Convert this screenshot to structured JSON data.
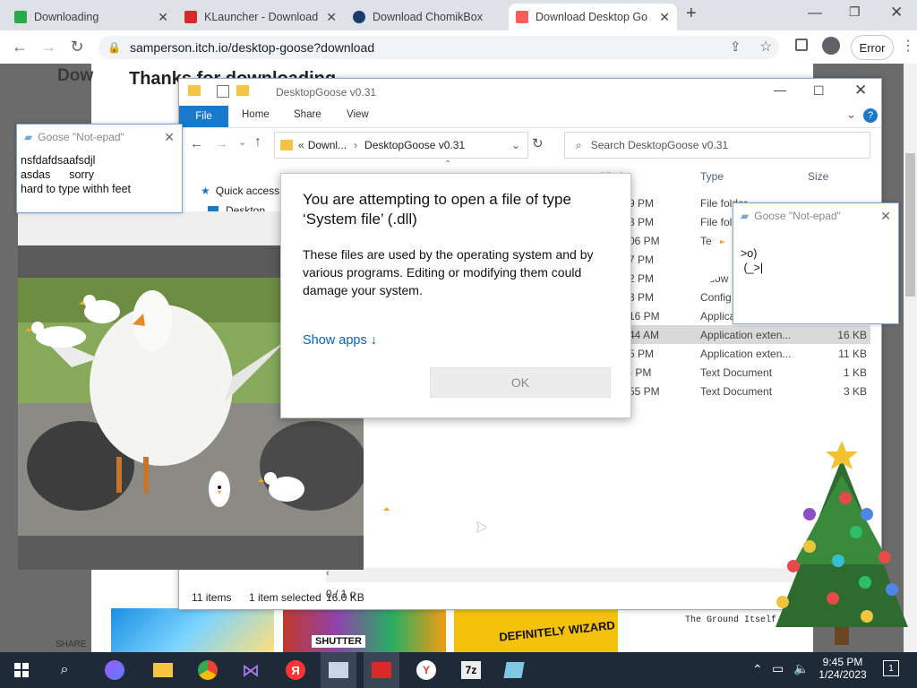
{
  "browser": {
    "tabs": [
      {
        "title": "Downloading",
        "favicon_color": "#2aa84a",
        "active": false
      },
      {
        "title": "KLauncher - Download",
        "favicon_color": "#d92a2a",
        "active": false
      },
      {
        "title": "Download ChomikBox",
        "favicon_color": "#1b3b6f",
        "active": false
      },
      {
        "title": "Download Desktop Go",
        "favicon_color": "#fa5c5c",
        "active": true
      }
    ],
    "url": "samperson.itch.io/desktop-goose?download",
    "error_label": "Error"
  },
  "page": {
    "heading_partial": "Thanks for downloading",
    "left_partial": "Dow",
    "share_partial": "SHARE",
    "bottom_card_text": "The Ground Itself",
    "card_shutter": "SHUTTER",
    "card_wizard": "DEFINITELY WIZARD"
  },
  "explorer": {
    "title": "DesktopGoose v0.31",
    "ribbon_tabs": [
      "File",
      "Home",
      "Share",
      "View"
    ],
    "path": [
      "Downl...",
      "DesktopGoose v0.31"
    ],
    "search_placeholder": "Search DesktopGoose v0.31",
    "nav_items": [
      "Quick access",
      "Desktop"
    ],
    "columns": [
      "modified",
      "Type",
      "Size"
    ],
    "rows": [
      {
        "time": "9 PM",
        "type": "File folder",
        "size": "",
        "selected": false
      },
      {
        "time": "3 PM",
        "type": "File fold",
        "size": "",
        "selected": false
      },
      {
        "time": "06 PM",
        "type": "Te",
        "size": "",
        "selected": false
      },
      {
        "time": "7 PM",
        "type": "",
        "size": "",
        "selected": false
      },
      {
        "time": "2 PM",
        "type": "indow",
        "size": "",
        "selected": false
      },
      {
        "time": "3 PM",
        "type": "Config",
        "size": "",
        "selected": false
      },
      {
        "time": "16 PM",
        "type": "Applica",
        "size": "",
        "selected": false
      },
      {
        "time": "44 AM",
        "type": "Application exten...",
        "size": "16 KB",
        "selected": true
      },
      {
        "time": "5 PM",
        "type": "Application exten...",
        "size": "11 KB",
        "selected": false
      },
      {
        "time": ") PM",
        "type": "Text Document",
        "size": "1 KB",
        "selected": false
      },
      {
        "time": "55 PM",
        "type": "Text Document",
        "size": "3 KB",
        "selected": false
      }
    ],
    "status": {
      "items": "11 items",
      "selected": "1 item selected",
      "size": "16.0 KB"
    },
    "page_counter": "0 / 1 o"
  },
  "dialog": {
    "title": "You are attempting to open a file of type ‘System file’ (.dll)",
    "body": "These files are used by the operating system and by various programs. Editing or modifying them could damage your system.",
    "show_apps": "Show apps ↓",
    "ok": "OK"
  },
  "notepad_left": {
    "title": "Goose \"Not-epad\"",
    "text": "nsfdafdsaafsdjl\nasdas      sorry\nhard to type withh feet"
  },
  "notepad_right": {
    "title": "Goose \"Not-epad\"",
    "text": ">o)\n (_>|"
  },
  "taskbar": {
    "time": "9:45 PM",
    "date": "1/24/2023",
    "notification_count": "1",
    "bg_color": "#1f2a38"
  }
}
